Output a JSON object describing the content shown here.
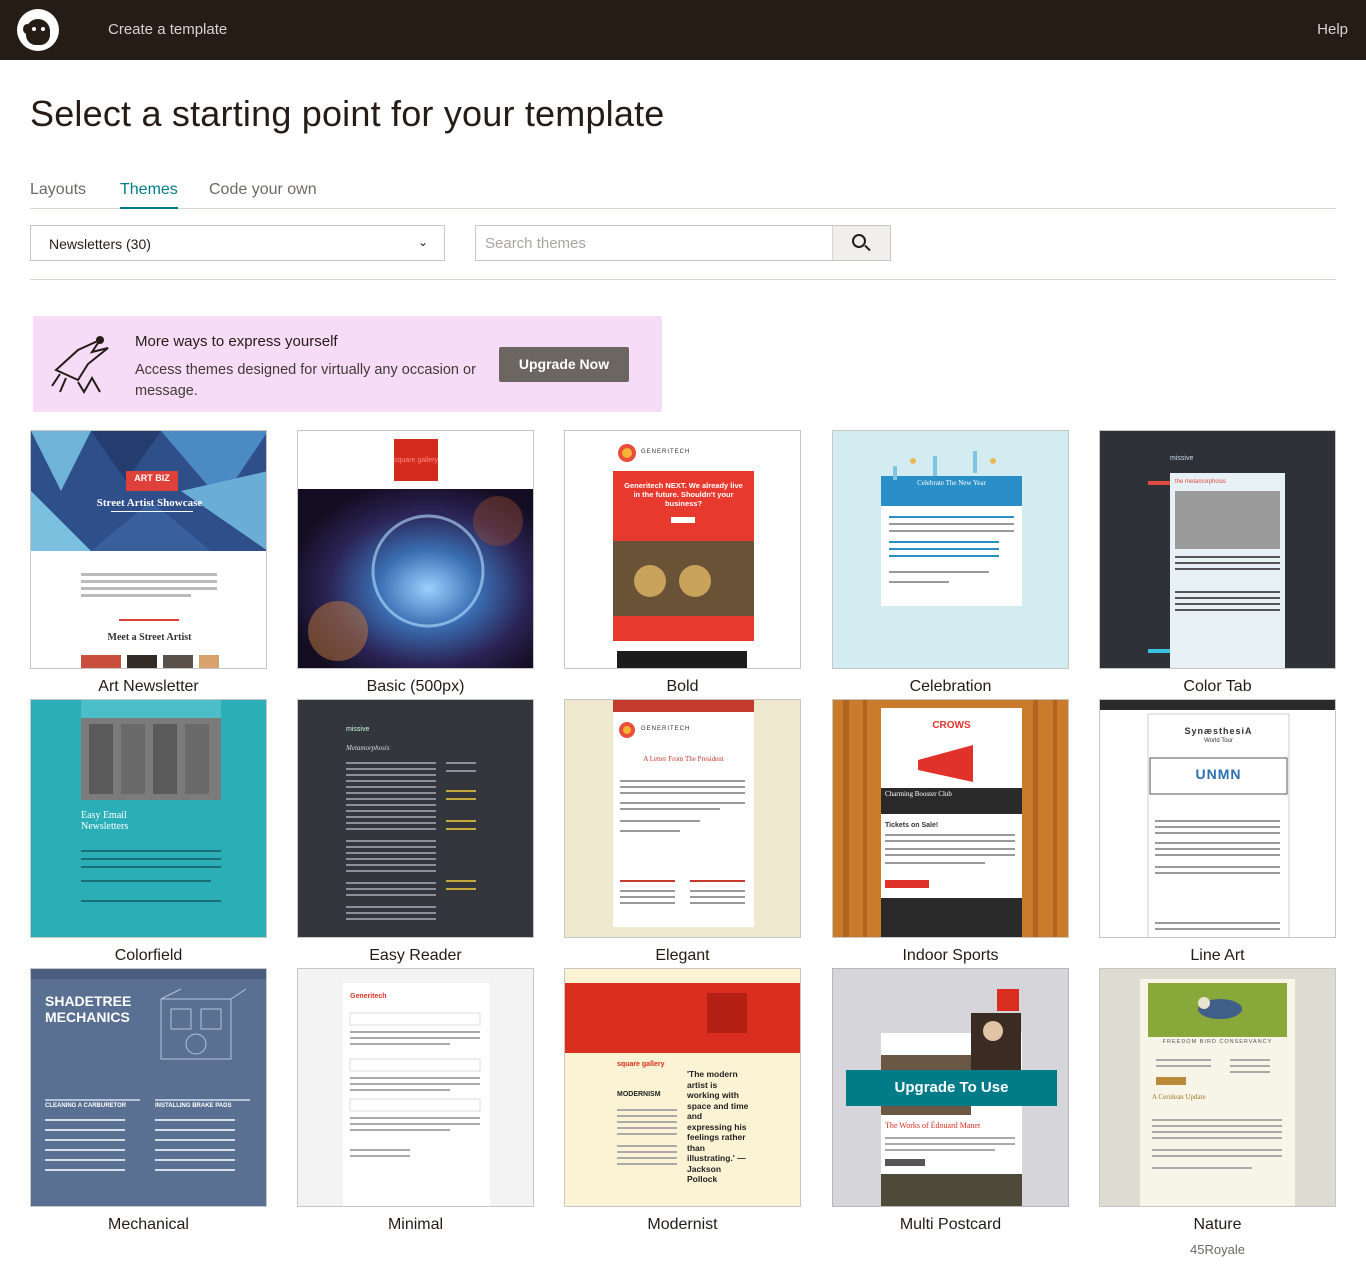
{
  "header": {
    "app_title": "Create a template",
    "help_label": "Help"
  },
  "page": {
    "title": "Select a starting point for your template"
  },
  "tabs": [
    {
      "label": "Layouts",
      "active": false
    },
    {
      "label": "Themes",
      "active": true
    },
    {
      "label": "Code your own",
      "active": false
    }
  ],
  "filter": {
    "category_selected": "Newsletters (30)",
    "search_placeholder": "Search themes"
  },
  "promo": {
    "heading": "More ways to express yourself",
    "text": "Access themes designed for virtually any occasion or message.",
    "button": "Upgrade Now"
  },
  "themes": [
    {
      "name": "Art Newsletter",
      "preview_heading": "Street Artist Showcase",
      "preview_sub": "Meet a Street Artist",
      "preview_logo": "ART BIZ"
    },
    {
      "name": "Basic (500px)",
      "preview_logo": "square gallery"
    },
    {
      "name": "Bold",
      "preview_logo": "GENERITECH",
      "preview_heading": "Generitech NEXT. We already live in the future. Shouldn't your business?"
    },
    {
      "name": "Celebration",
      "preview_heading": "Celebrate The New Year"
    },
    {
      "name": "Color Tab",
      "preview_logo": "missive",
      "preview_heading": "the metamorphosis"
    },
    {
      "name": "Colorfield",
      "preview_heading": "Easy Email Newsletters"
    },
    {
      "name": "Easy Reader",
      "preview_logo": "missive",
      "preview_heading": "Metamorphosis"
    },
    {
      "name": "Elegant",
      "preview_logo": "GENERITECH",
      "preview_heading": "A Letter From The President"
    },
    {
      "name": "Indoor Sports",
      "preview_logo": "CROWS",
      "preview_heading": "Charming Booster Club",
      "preview_sub": "Tickets on Sale!"
    },
    {
      "name": "Line Art",
      "preview_heading": "SynæsthesiA",
      "preview_sub": "World Tour",
      "preview_logo": "UNMN"
    },
    {
      "name": "Mechanical",
      "preview_heading": "SHADETREE MECHANICS",
      "preview_sub": "CLEANING A CARBURETOR",
      "preview_sub2": "INSTALLING BRAKE PADS"
    },
    {
      "name": "Minimal",
      "preview_logo": "Generitech"
    },
    {
      "name": "Modernist",
      "preview_logo": "square gallery",
      "preview_heading": "MODERNISM",
      "preview_quote": "'The modern artist is working with space and time and expressing his feelings rather than illustrating.' — Jackson Pollock"
    },
    {
      "name": "Multi Postcard",
      "overlay_button": "Upgrade To Use",
      "preview_heading": "The Works of Édouard Manet"
    },
    {
      "name": "Nature",
      "preview_heading": "FREEDOM BIRD CONSERVANCY",
      "preview_sub": "A Cerulean Update",
      "sublabel": "45Royale"
    }
  ]
}
